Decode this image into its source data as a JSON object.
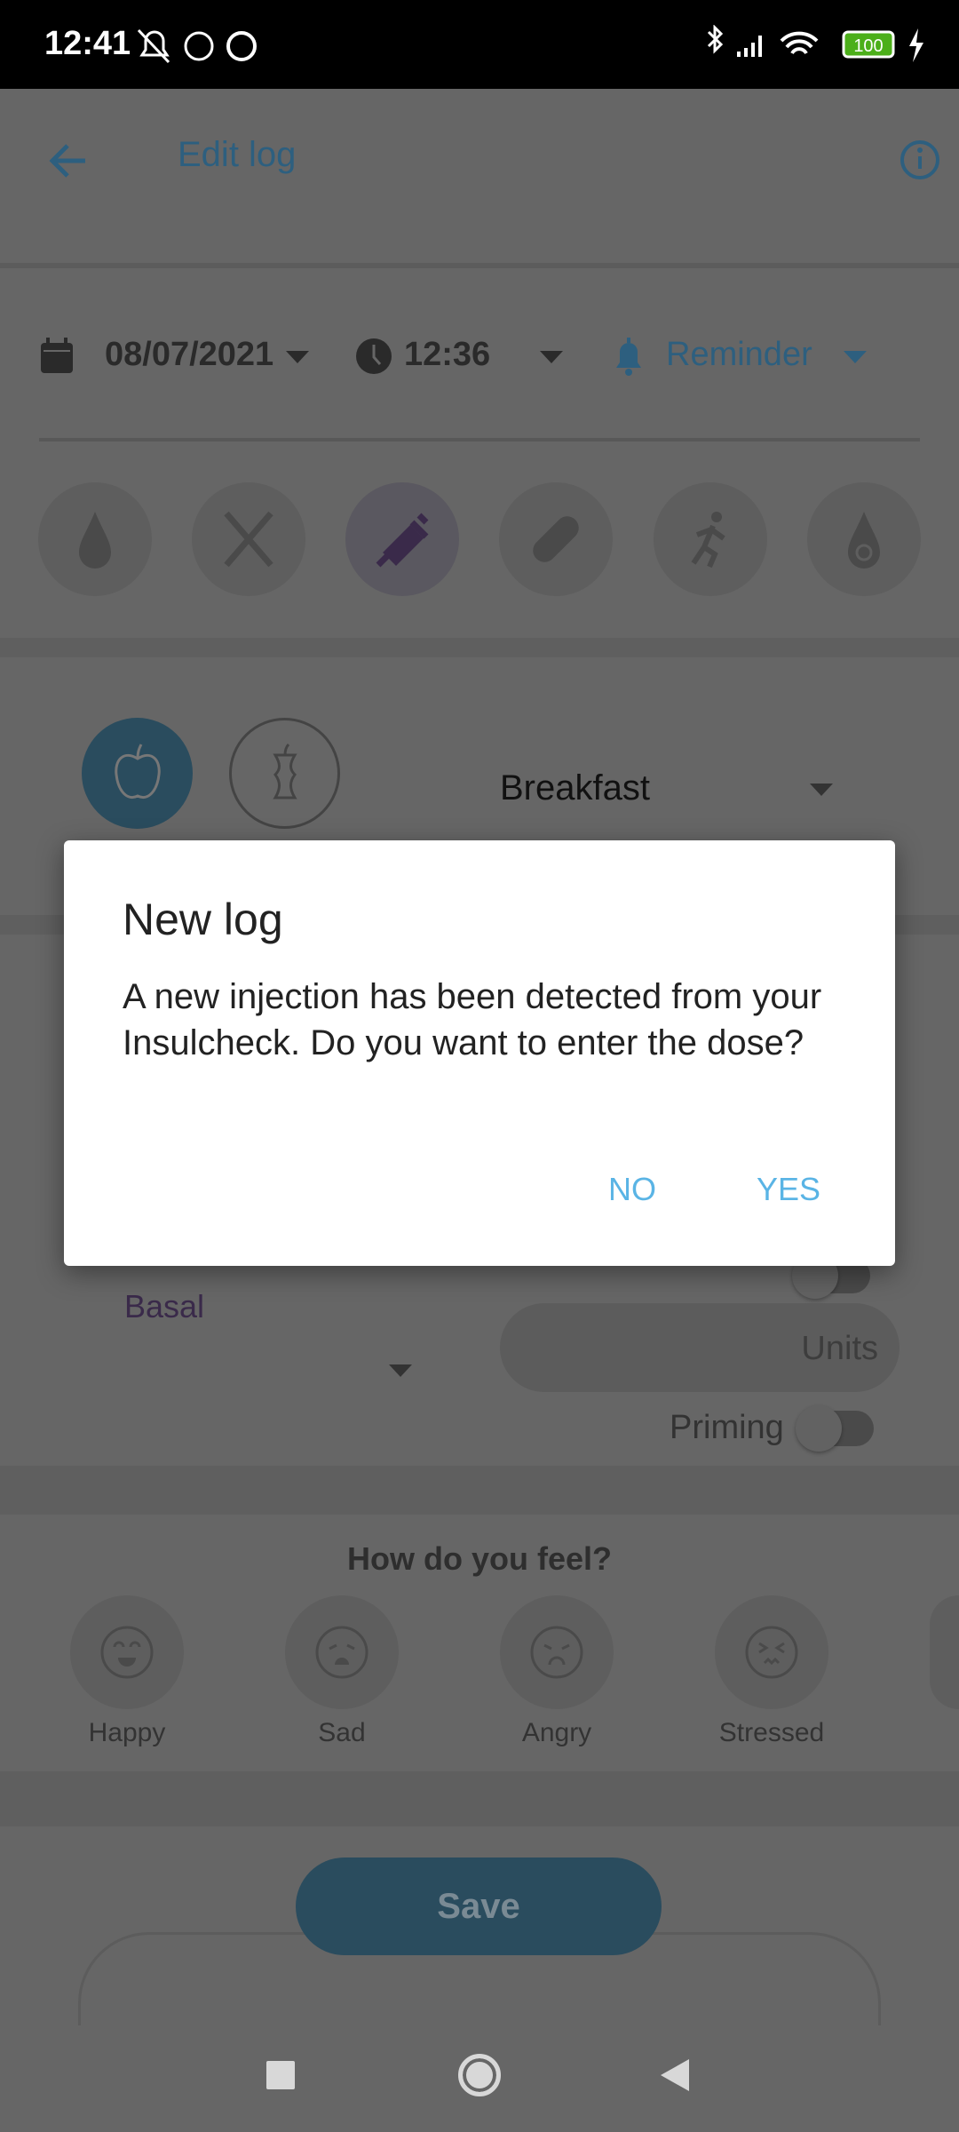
{
  "status_bar": {
    "time": "12:41",
    "battery": "100",
    "icons": [
      "mute-icon",
      "messenger-icon",
      "app-icon",
      "bluetooth-icon",
      "signal-icon",
      "wifi-icon",
      "battery-icon",
      "charging-icon"
    ]
  },
  "header": {
    "title": "Edit log",
    "back_icon": "arrow-left-icon",
    "info_icon": "info-icon"
  },
  "datetime": {
    "date": "08/07/2021",
    "time": "12:36",
    "reminder": "Reminder"
  },
  "categories": [
    {
      "icon": "blood-drop-icon"
    },
    {
      "icon": "fork-knife-icon"
    },
    {
      "icon": "syringe-icon",
      "selected": true
    },
    {
      "icon": "pill-icon"
    },
    {
      "icon": "running-icon"
    },
    {
      "icon": "target-drop-icon"
    }
  ],
  "meal": {
    "selected": "Breakfast",
    "options_icons": [
      "apple-icon",
      "apple-core-icon"
    ]
  },
  "insulin": {
    "type": "Basal",
    "units_placeholder": "Units",
    "priming_label": "Priming",
    "priming_on": false
  },
  "mood": {
    "title": "How do you feel?",
    "items": [
      {
        "label": "Happy"
      },
      {
        "label": "Sad"
      },
      {
        "label": "Angry"
      },
      {
        "label": "Stressed"
      }
    ]
  },
  "save_label": "Save",
  "dialog": {
    "title": "New log",
    "message": "A new injection has been detected from your Insulcheck. Do you want to enter the dose?",
    "no": "NO",
    "yes": "YES"
  },
  "colors": {
    "accent": "#5ab4e5",
    "dialog_button": "#5ab4e5",
    "selected_category": "#9169b9",
    "battery": "#4caf1a"
  }
}
